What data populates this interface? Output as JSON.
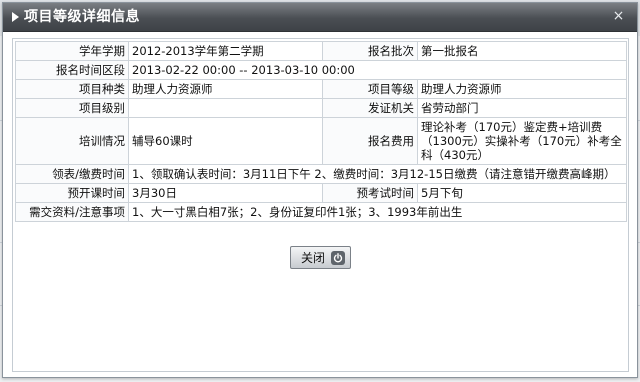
{
  "dialog": {
    "title": "项目等级详细信息",
    "close_glyph": "×",
    "close_button_label": "关闭"
  },
  "rows": [
    {
      "label": "学年学期",
      "value": "2012-2013学年第二学期",
      "label2": "报名批次",
      "value2": "第一批报名"
    },
    {
      "label": "报名时间区段",
      "value": "2013-02-22 00:00 -- 2013-03-10 00:00"
    },
    {
      "label": "项目种类",
      "value": "助理人力资源师",
      "label2": "项目等级",
      "value2": "助理人力资源师"
    },
    {
      "label": "项目级别",
      "value": "",
      "label2": "发证机关",
      "value2": "省劳动部门"
    },
    {
      "label": "培训情况",
      "value": "辅导60课时",
      "label2": "报名费用",
      "value2": "理论补考（170元）鉴定费+培训费（1300元）实操补考（170元）补考全科（430元）"
    },
    {
      "label": "领表/缴费时间",
      "value": "1、领取确认表时间：3月11日下午 2、缴费时间：3月12-15日缴费（请注意错开缴费高峰期）"
    },
    {
      "label": "预开课时间",
      "value": "3月30日",
      "label2": "预考试时间",
      "value2": "5月下旬"
    },
    {
      "label": "需交资料/注意事项",
      "value": "1、大一寸黑白相7张；2、身份证复印件1张；3、1993年前出生"
    }
  ],
  "icons": {
    "close": "close-icon",
    "power": "power-icon",
    "title_arrow": "triangle-right-icon"
  },
  "colors": {
    "titlebar": "#4a4e53",
    "border": "#cdd3d9",
    "button": "#c7cbd0"
  }
}
